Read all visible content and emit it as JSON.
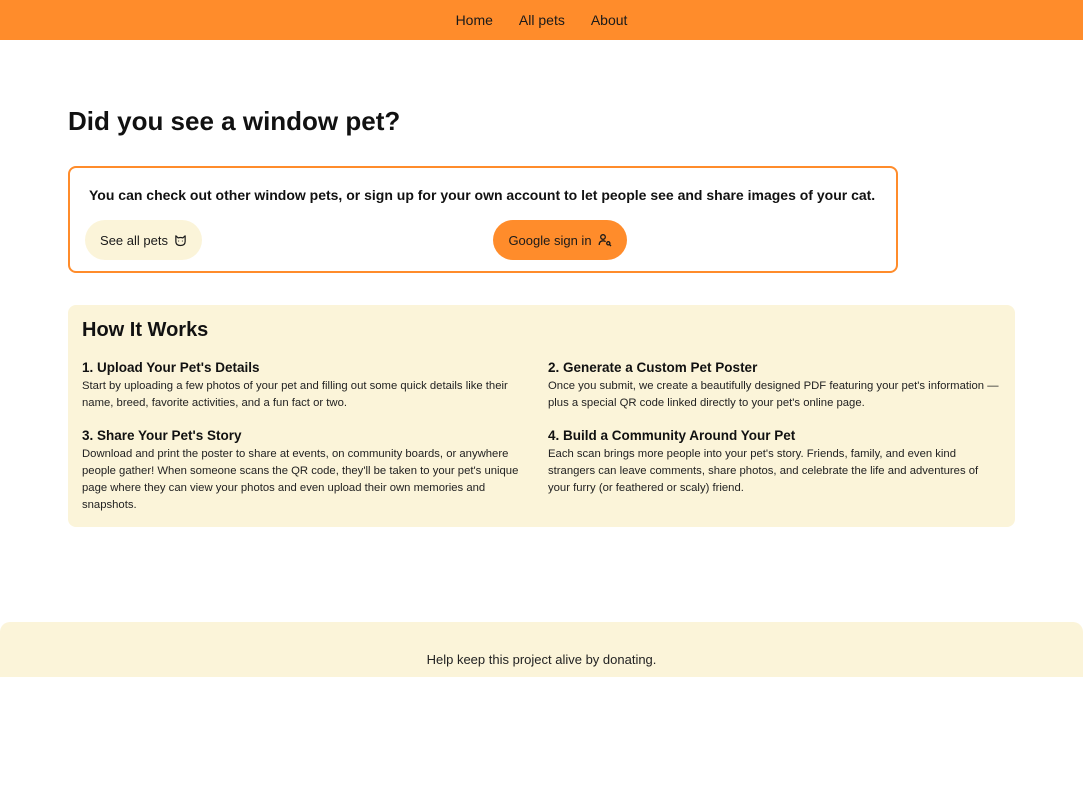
{
  "nav": {
    "items": [
      {
        "label": "Home"
      },
      {
        "label": "All pets"
      },
      {
        "label": "About"
      }
    ]
  },
  "hero": {
    "title": "Did you see a window pet?"
  },
  "callout": {
    "text": "You can check out other window pets, or sign up for your own account to let people see and share images of your cat.",
    "see_all_label": "See all pets",
    "see_all_icon": "cat-icon",
    "google_label": "Google sign in",
    "google_icon": "user-key-icon"
  },
  "how_it_works": {
    "title": "How It Works",
    "steps": [
      {
        "title": "1. Upload Your Pet's Details",
        "text": "Start by uploading a few photos of your pet and filling out some quick details like their name, breed, favorite activities, and a fun fact or two."
      },
      {
        "title": "2. Generate a Custom Pet Poster",
        "text": "Once you submit, we create a beautifully designed PDF featuring your pet's information — plus a special QR code linked directly to your pet's online page."
      },
      {
        "title": "3. Share Your Pet's Story",
        "text": "Download and print the poster to share at events, on community boards, or anywhere people gather! When someone scans the QR code, they'll be taken to your pet's unique page where they can view your photos and even upload their own memories and snapshots."
      },
      {
        "title": "4. Build a Community Around Your Pet",
        "text": "Each scan brings more people into your pet's story. Friends, family, and even kind strangers can leave comments, share photos, and celebrate the life and adventures of your furry (or feathered or scaly) friend."
      }
    ]
  },
  "footer": {
    "donate_text": "Help keep this project alive by donating."
  },
  "colors": {
    "accent": "#ff8c2b",
    "panel": "#fbf4d9"
  }
}
